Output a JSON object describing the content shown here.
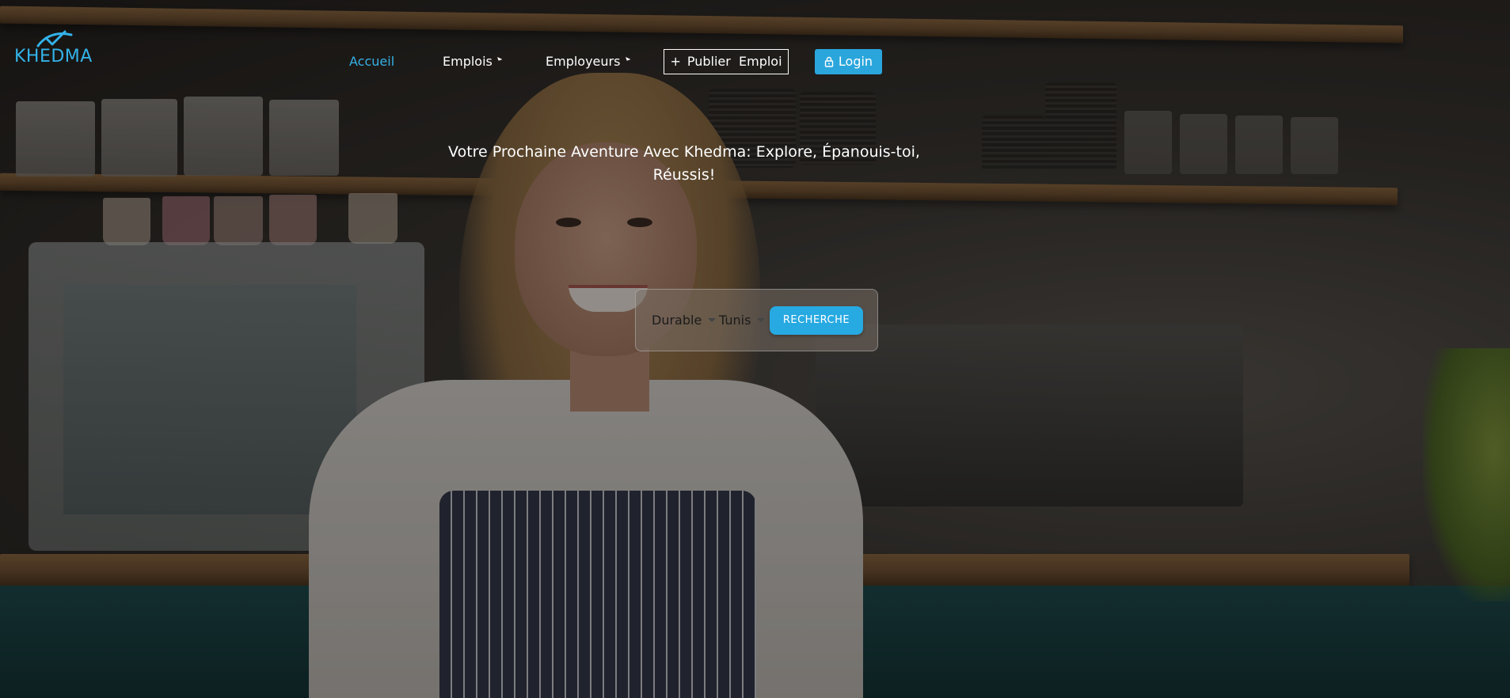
{
  "brand": {
    "name": "KHEDMA",
    "color": "#33b3ea"
  },
  "nav": {
    "items": [
      {
        "label": "Accueil",
        "active": true,
        "has_dropdown": false
      },
      {
        "label": "Emplois",
        "active": false,
        "has_dropdown": true
      },
      {
        "label": "Employeurs",
        "active": false,
        "has_dropdown": true
      }
    ],
    "publish_button": {
      "icon": "plus-icon",
      "label": "Publier  Emploi"
    },
    "login_button": {
      "icon": "lock-icon",
      "label": "Login"
    }
  },
  "hero": {
    "headline": "Votre Prochaine Aventure Avec Khedma: Explore, Épanouis-toi, Réussis!"
  },
  "search": {
    "type_select": {
      "value": "Durable"
    },
    "location_select": {
      "value": "Tunis"
    },
    "button_label": "RECHERCHE"
  },
  "colors": {
    "accent": "#27a9e1",
    "active_link": "#36b1e6",
    "text": "#ffffff"
  }
}
